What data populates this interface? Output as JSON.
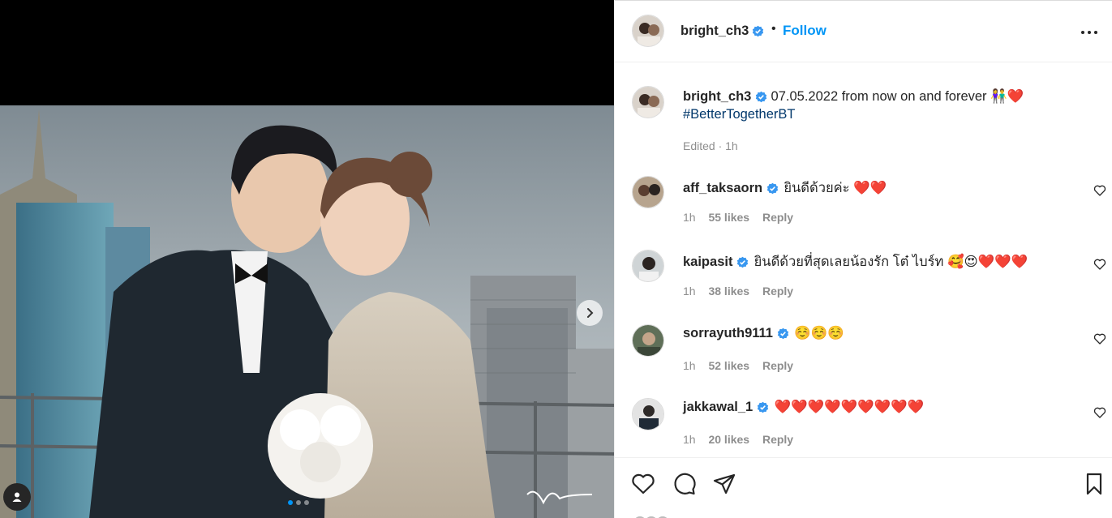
{
  "post": {
    "author": "bright_ch3",
    "follow_label": "Follow",
    "separator": "•",
    "caption_text": "07.05.2022 from now on and forever 👫❤️",
    "hashtag": "#BetterTogetherBT",
    "edited_label": "Edited · 1h",
    "carousel_dots": 3,
    "carousel_active": 0
  },
  "comments": [
    {
      "username": "aff_taksaorn",
      "text": "ยินดีด้วยค่ะ ❤️❤️",
      "time": "1h",
      "likes": "55 likes",
      "reply": "Reply"
    },
    {
      "username": "kaipasit",
      "text": "ยินดีด้วยที่สุดเลยน้องรัก โต๋ ไบร์ท 🥰😍❤️❤️❤️",
      "time": "1h",
      "likes": "38 likes",
      "reply": "Reply"
    },
    {
      "username": "sorrayuth9111",
      "text": "☺️☺️☺️",
      "time": "1h",
      "likes": "52 likes",
      "reply": "Reply"
    },
    {
      "username": "jakkawal_1",
      "text": "❤️❤️❤️❤️❤️❤️❤️❤️❤️",
      "time": "1h",
      "likes": "20 likes",
      "reply": "Reply"
    }
  ],
  "icons": {
    "verified": "verified-badge-icon",
    "like": "heart-icon",
    "comment": "comment-bubble-icon",
    "share": "paper-plane-icon",
    "save": "bookmark-icon",
    "more": "more-options-icon",
    "next": "chevron-right-icon",
    "tags": "user-tag-icon"
  },
  "colors": {
    "accent": "#0095f6",
    "verified": "#3897f0",
    "hashtag": "#00376b",
    "meta": "#8e8e8e"
  }
}
